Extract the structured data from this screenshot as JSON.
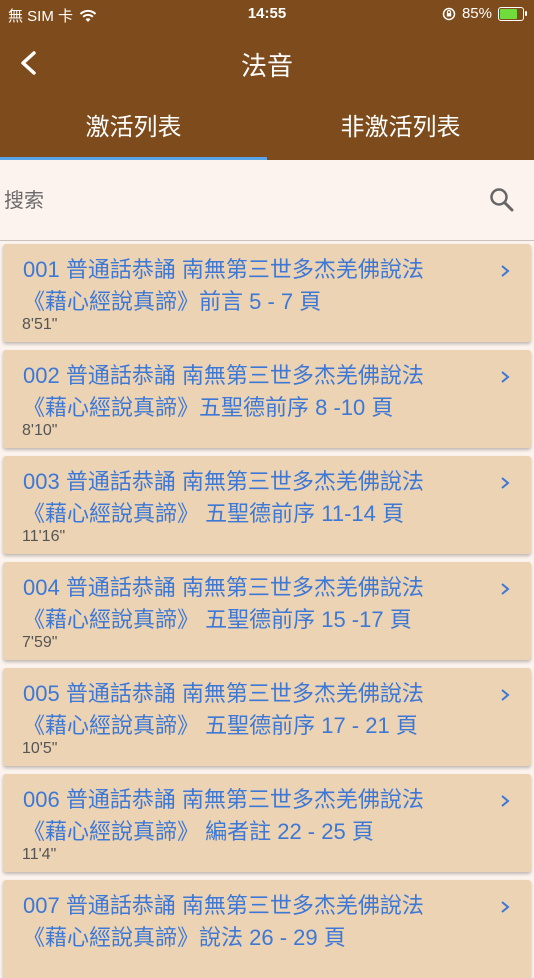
{
  "status": {
    "carrier": "無 SIM 卡",
    "time": "14:55",
    "battery": "85%"
  },
  "appbar": {
    "title": "法音"
  },
  "tabs": [
    {
      "label": "激活列表",
      "active": true
    },
    {
      "label": "非激活列表",
      "active": false
    }
  ],
  "search": {
    "placeholder": "搜索"
  },
  "colors": {
    "header": "#7d4b1c",
    "tab_indicator": "#58a4e6",
    "item_bg": "#ecd3b3",
    "item_text": "#3d78d6"
  },
  "items": [
    {
      "title": "001 普通話恭誦 南無第三世多杰羌佛說法",
      "subtitle": "《藉心經說真諦》前言 5 - 7 頁",
      "duration": "8'51\""
    },
    {
      "title": "002 普通話恭誦 南無第三世多杰羌佛說法",
      "subtitle": "《藉心經說真諦》五聖德前序 8 -10 頁",
      "duration": "8'10\""
    },
    {
      "title": "003 普通話恭誦 南無第三世多杰羌佛說法",
      "subtitle": "《藉心經說真諦》 五聖德前序 11-14 頁",
      "duration": "11'16\""
    },
    {
      "title": "004 普通話恭誦 南無第三世多杰羌佛說法",
      "subtitle": "《藉心經說真諦》 五聖德前序 15 -17 頁",
      "duration": "7'59\""
    },
    {
      "title": "005 普通話恭誦 南無第三世多杰羌佛說法",
      "subtitle": "《藉心經說真諦》 五聖德前序 17 - 21 頁",
      "duration": "10'5\""
    },
    {
      "title": "006 普通話恭誦 南無第三世多杰羌佛說法",
      "subtitle": "《藉心經說真諦》 編者註 22 - 25 頁",
      "duration": "11'4\""
    },
    {
      "title": "007 普通話恭誦 南無第三世多杰羌佛說法",
      "subtitle": "《藉心經說真諦》說法 26 - 29 頁",
      "duration": ""
    }
  ]
}
